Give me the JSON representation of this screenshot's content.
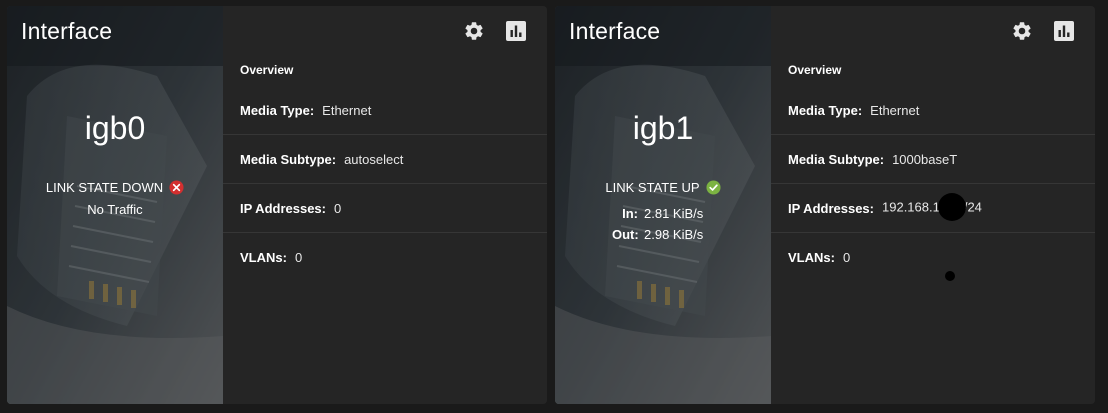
{
  "cards": [
    {
      "title": "Interface",
      "name": "igb0",
      "link_state": "LINK STATE DOWN",
      "status": "down",
      "traffic": "No Traffic",
      "overview_title": "Overview",
      "props": [
        {
          "label": "Media Type:",
          "value": "Ethernet"
        },
        {
          "label": "Media Subtype:",
          "value": "autoselect"
        },
        {
          "label": "IP Addresses:",
          "value": "0"
        },
        {
          "label": "VLANs:",
          "value": "0"
        }
      ],
      "icons": {
        "settings": "gear-icon",
        "stats": "bar-chart-icon",
        "status": "error-circle-icon"
      }
    },
    {
      "title": "Interface",
      "name": "igb1",
      "link_state": "LINK STATE UP",
      "status": "up",
      "in_label": "In:",
      "in_value": "2.81 KiB/s",
      "out_label": "Out:",
      "out_value": "2.98 KiB/s",
      "overview_title": "Overview",
      "props": [
        {
          "label": "Media Type:",
          "value": "Ethernet"
        },
        {
          "label": "Media Subtype:",
          "value": "1000baseT"
        },
        {
          "label": "IP Addresses:",
          "value_prefix": "192.168.1",
          "value_suffix": "/24"
        },
        {
          "label": "VLANs:",
          "value": "0"
        }
      ],
      "icons": {
        "settings": "gear-icon",
        "stats": "bar-chart-icon",
        "status": "check-circle-icon"
      }
    }
  ],
  "colors": {
    "background": "#1a1a1a",
    "card": "#252525",
    "status_down": "#d32f2f",
    "status_up": "#7cb342",
    "divider": "#363636"
  }
}
